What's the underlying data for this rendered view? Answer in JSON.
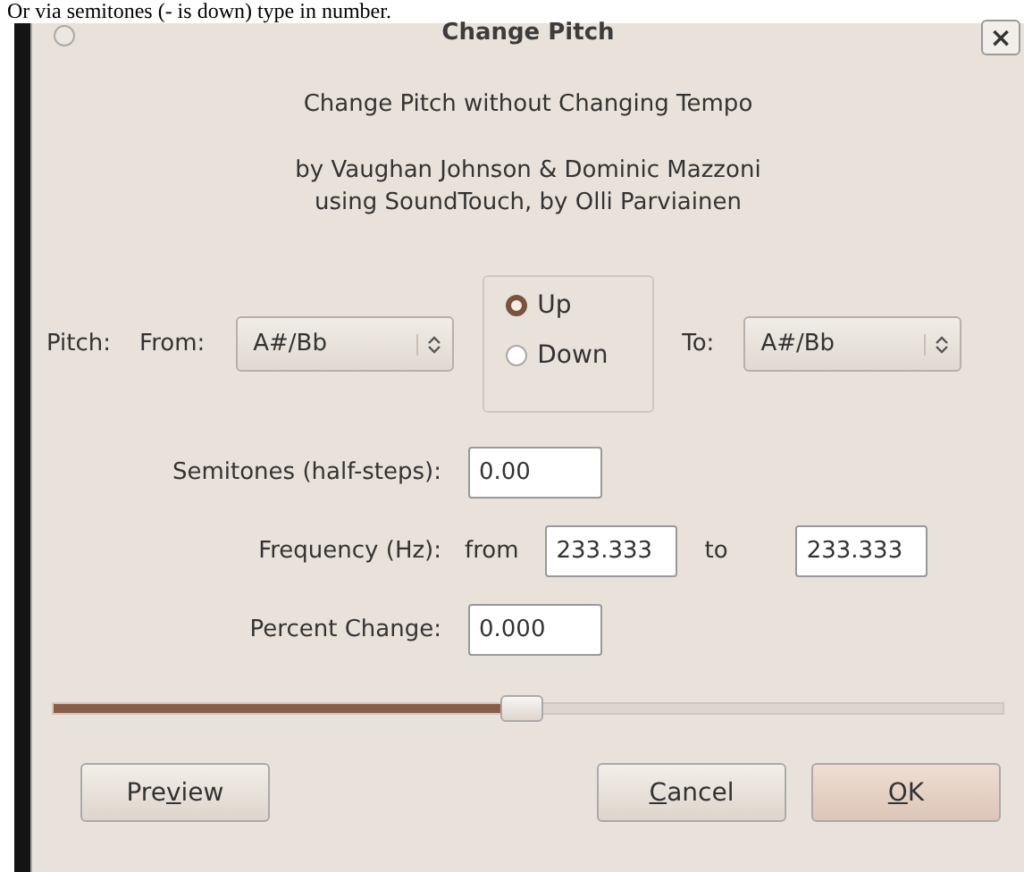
{
  "page_text": "Or via semitones (- is down) type in number.",
  "window": {
    "title": "Change Pitch",
    "close": "×"
  },
  "heading": "Change Pitch without Changing Tempo",
  "credits": [
    "by Vaughan Johnson & Dominic Mazzoni",
    "using SoundTouch, by Olli Parviainen"
  ],
  "pitch": {
    "label": "Pitch:",
    "from_label": "From:",
    "from_value": "A#/Bb",
    "to_label": "To:",
    "to_value": "A#/Bb",
    "direction": [
      {
        "label": "Up",
        "selected": true
      },
      {
        "label": "Down",
        "selected": false
      }
    ]
  },
  "semitones": {
    "label": "Semitones (half-steps):",
    "value": "0.00"
  },
  "frequency": {
    "label": "Frequency (Hz):",
    "from_label": "from",
    "from_value": "233.333",
    "to_label": "to",
    "to_value": "233.333"
  },
  "percent": {
    "label": "Percent Change:",
    "value": "0.000"
  },
  "slider": {
    "level": 0.49
  },
  "buttons": [
    {
      "pre": "Pre",
      "key": "v",
      "post": "iew",
      "kind": "plain"
    },
    {
      "key": "C",
      "post": "ancel",
      "kind": "plain"
    },
    {
      "key": "O",
      "post": "K",
      "kind": "default"
    }
  ]
}
